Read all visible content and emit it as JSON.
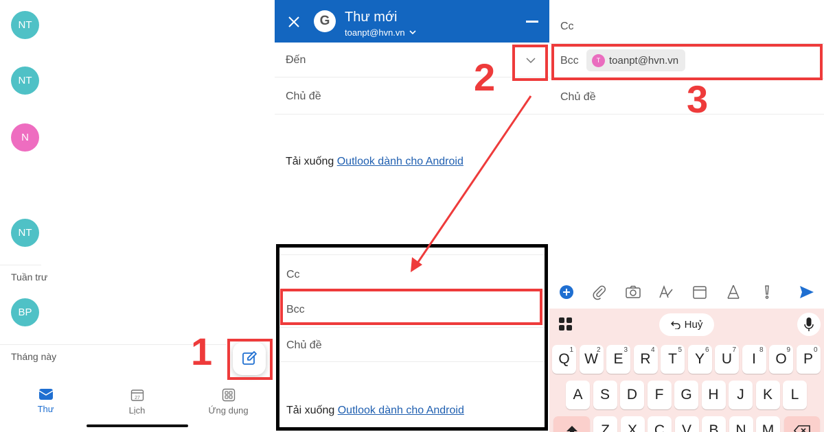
{
  "mail_list": {
    "avatars": [
      {
        "initials": "NT",
        "color": "#4fc1c6"
      },
      {
        "initials": "NT",
        "color": "#4fc1c6"
      },
      {
        "initials": "N",
        "color": "#ee6dc0"
      },
      {
        "initials": "NT",
        "color": "#4fc1c6"
      },
      {
        "initials": "BP",
        "color": "#4fc1c6"
      }
    ],
    "sections": {
      "this_week": "Tuần trư",
      "this_month": "Tháng này"
    },
    "compose_icon": "compose-icon",
    "nav": [
      {
        "label": "Thư",
        "icon": "mail-icon",
        "active": true
      },
      {
        "label": "Lịch",
        "icon": "calendar-icon",
        "calendar_day": "27",
        "active": false
      },
      {
        "label": "Ứng dụng",
        "icon": "apps-icon",
        "active": false
      }
    ]
  },
  "compose": {
    "title": "Thư mới",
    "account": "toanpt@hvn.vn",
    "account_logo": "G",
    "to_label": "Đến",
    "subject_label": "Chủ đề",
    "signature_prefix": "Tải xuống ",
    "signature_link": "Outlook dành cho Android",
    "expanded": {
      "cc_label": "Cc",
      "bcc_label": "Bcc",
      "subject_label": "Chủ đề",
      "signature_prefix": "Tải xuống ",
      "signature_link": "Outlook dành cho Android"
    }
  },
  "compose_filled": {
    "cc_label": "Cc",
    "bcc_label": "Bcc",
    "bcc_recipient": "toanpt@hvn.vn",
    "bcc_recipient_initial": "T",
    "subject_label": "Chủ đề",
    "toolbar_icons": [
      "add-icon",
      "attach-icon",
      "camera-icon",
      "format-icon",
      "calendar-icon",
      "draw-icon",
      "priority-icon",
      "send-icon"
    ]
  },
  "keyboard": {
    "undo_label": "Huỷ",
    "row1": [
      {
        "k": "Q",
        "h": "1"
      },
      {
        "k": "W",
        "h": "2"
      },
      {
        "k": "E",
        "h": "3"
      },
      {
        "k": "R",
        "h": "4"
      },
      {
        "k": "T",
        "h": "5"
      },
      {
        "k": "Y",
        "h": "6"
      },
      {
        "k": "U",
        "h": "7"
      },
      {
        "k": "I",
        "h": "8"
      },
      {
        "k": "O",
        "h": "9"
      },
      {
        "k": "P",
        "h": "0"
      }
    ],
    "row2": [
      "A",
      "S",
      "D",
      "F",
      "G",
      "H",
      "J",
      "K",
      "L"
    ],
    "row3": [
      "Z",
      "X",
      "C",
      "V",
      "B",
      "N",
      "M"
    ]
  },
  "annotations": {
    "step1": "1",
    "step2": "2",
    "step3": "3",
    "accent_color": "#ee3b3b"
  }
}
